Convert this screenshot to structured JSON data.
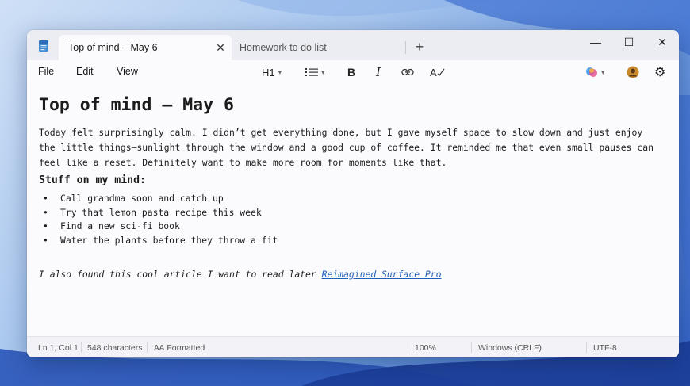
{
  "tabs": {
    "active": {
      "title": "Top of mind – May 6",
      "close": "✕"
    },
    "inactive": {
      "title": "Homework to do list"
    },
    "new_tab": "+"
  },
  "window_controls": {
    "minimize": "—",
    "maximize": "☐",
    "close": "✕"
  },
  "menu": {
    "file": "File",
    "edit": "Edit",
    "view": "View"
  },
  "toolbar": {
    "heading": "H1",
    "bold": "B",
    "italic": "I",
    "spellcheck": "A",
    "icons": [
      "list-icon",
      "link-icon",
      "spellcheck-icon",
      "copilot-icon",
      "profile-icon",
      "settings-icon"
    ]
  },
  "document": {
    "title": "Top of mind – May 6",
    "paragraph_lines": [
      "Today felt surprisingly calm. I didn’t get everything done, but I gave myself space to slow down and just enjoy",
      "the little things—sunlight through the window and a good cup of coffee. It reminded me that even small pauses can",
      "feel like a reset. Definitely want to make more room for moments like that."
    ],
    "section_heading": "Stuff on my mind:",
    "bullets": [
      "Call grandma soon and catch up",
      "Try that lemon pasta recipe this week",
      "Find a new sci-fi book",
      "Water the plants before they throw a fit"
    ],
    "closing_text": "I also found this cool article I want to read later ",
    "link_text": "Reimagined Surface Pro"
  },
  "status": {
    "position": "Ln 1, Col 1",
    "characters": "548 characters",
    "format_icon": "AA",
    "format": "Formatted",
    "zoom": "100%",
    "line_ending": "Windows (CRLF)",
    "encoding": "UTF-8"
  },
  "colors": {
    "accent": "#1f5fb8",
    "window_bg": "#fbfbfd",
    "titlebar_bg": "#ecedf3"
  }
}
